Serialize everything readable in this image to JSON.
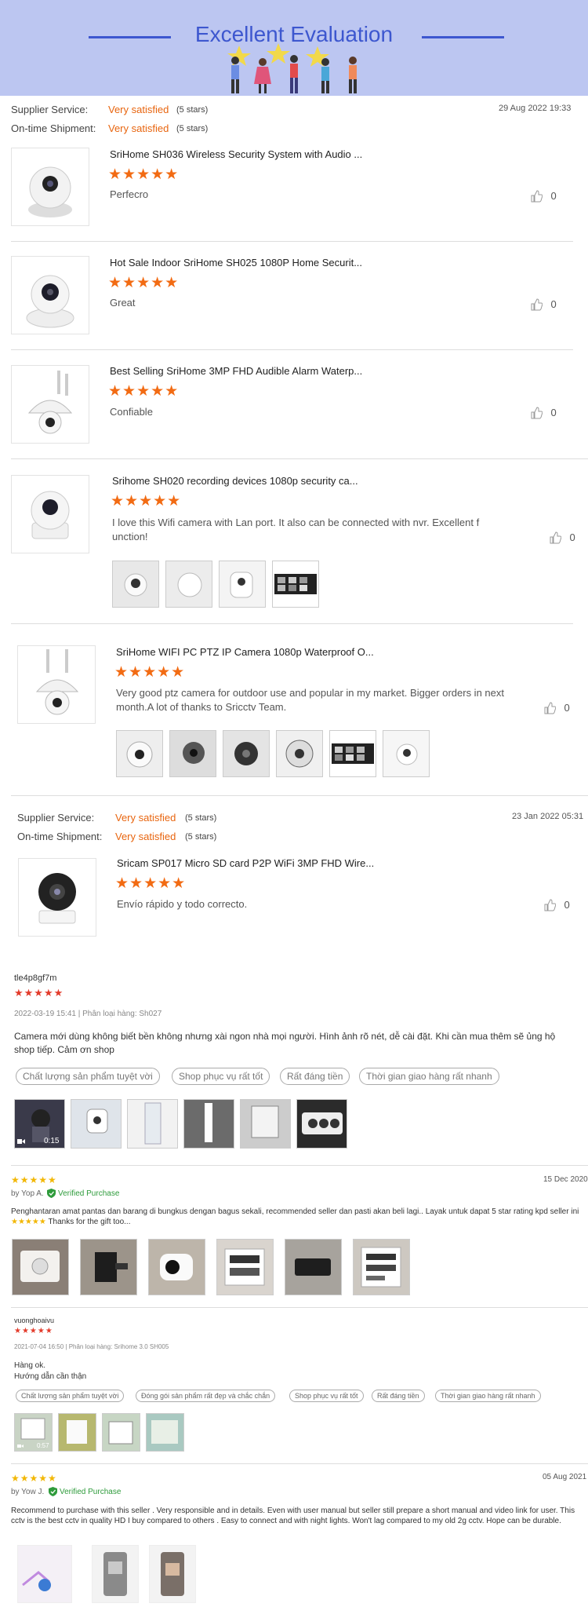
{
  "banner": {
    "title": "Excellent Evaluation"
  },
  "section1": {
    "supplier_label": "Supplier Service:",
    "supplier_value": "Very satisfied",
    "supplier_stars": "(5 stars)",
    "shipment_label": "On-time Shipment:",
    "shipment_value": "Very satisfied",
    "shipment_stars": "(5 stars)",
    "date": "29 Aug 2022 19:33"
  },
  "products": [
    {
      "title": "SriHome SH036 Wireless Security System with Audio ...",
      "stars": "★★★★★",
      "text": "Perfecro",
      "likes": "0"
    },
    {
      "title": "Hot Sale Indoor SriHome SH025 1080P Home Securit...",
      "stars": "★★★★★",
      "text": "Great",
      "likes": "0"
    },
    {
      "title": "Best Selling SriHome 3MP FHD Audible Alarm Waterp...",
      "stars": "★★★★★",
      "text": "Confiable",
      "likes": "0"
    },
    {
      "title": "Srihome SH020 recording devices 1080p security ca...",
      "stars": "★★★★★",
      "text": "I love this Wifi camera with Lan port. It also can be connected with nvr. Excellent f unction!",
      "likes": "0"
    },
    {
      "title": "SriHome WIFI PC PTZ IP Camera 1080p Waterproof O...",
      "stars": "★★★★★",
      "text": "Very good ptz camera for outdoor use and popular in my market. Bigger orders in next month.A lot of thanks to Sricctv Team.",
      "likes": "0"
    }
  ],
  "section2": {
    "supplier_label": "Supplier Service:",
    "supplier_value": "Very satisfied",
    "supplier_stars": "(5 stars)",
    "shipment_label": "On-time Shipment:",
    "shipment_value": "Very satisfied",
    "shipment_stars": "(5 stars)",
    "date": "23 Jan 2022 05:31",
    "product": {
      "title": "Sricam SP017 Micro SD card P2P WiFi 3MP FHD Wire...",
      "stars": "★★★★★",
      "text": "Envío rápido y todo correcto.",
      "likes": "0"
    }
  },
  "review_vn1": {
    "user": "tle4p8gf7m",
    "stars": "★★★★★",
    "meta": "2022-03-19 15:41 | Phân loại hàng: Sh027",
    "text": "Camera mới dùng không biết bền không nhưng xài ngon nhà mọi người. Hình ảnh rõ nét, dễ cài đặt. Khi cần mua thêm sẽ ủng hộ shop tiếp. Cảm ơn shop",
    "tags": [
      "Chất lượng sản phẩm tuyệt vời",
      "Shop phục vụ rất tốt",
      "Rất đáng tiền",
      "Thời gian giao hàng rất nhanh"
    ],
    "video_time": "0:15"
  },
  "review_id": {
    "stars": "★★★★★",
    "date": "15 Dec 2020",
    "by": "by Yop A.",
    "verified": "Verified Purchase",
    "text": "Penghantaran amat pantas dan barang di bungkus dengan bagus sekali, recommended seller dan pasti akan beli lagi.. Layak untuk dapat 5 star rating kpd seller ini",
    "emoji_stars": "★★★★★",
    "text_end": "Thanks for the gift too..."
  },
  "review_vn2": {
    "user": "vuonghoaivu",
    "stars": "★★★★★",
    "meta": "2021-07-04 16:50 | Phân loại hàng: Srihome 3.0 SH005",
    "line1": "Hàng ok.",
    "line2": "Hướng dẫn cần thận",
    "tags": [
      "Chất lượng sản phẩm tuyệt vời",
      "Đóng gói sản phẩm rất đẹp và chắc chắn",
      "Shop phục vụ rất tốt",
      "Rất đáng tiền",
      "Thời gian giao hàng rất nhanh"
    ],
    "video_time": "0:57"
  },
  "review_en": {
    "stars": "★★★★★",
    "date": "05 Aug 2021",
    "by": "by Yow J.",
    "verified": "Verified Purchase",
    "text": "Recommend to purchase with this seller . Very responsible and in details. Even with user manual but seller still prepare a short manual and video link for user. This cctv is the best cctv in quality HD I buy compared to others . Easy to connect and with night lights. Won't lag compared to my old 2g cctv. Hope can be durable."
  },
  "colors": {
    "accent": "#e8650f",
    "star": "#f26b13",
    "banner_bg": "#bcc6f1",
    "banner_text": "#3d57cf",
    "verified": "#2e9b3b"
  },
  "icons": {
    "like": "thumbs-up-icon",
    "check": "verified-shield-icon",
    "video": "video-camera-icon"
  }
}
